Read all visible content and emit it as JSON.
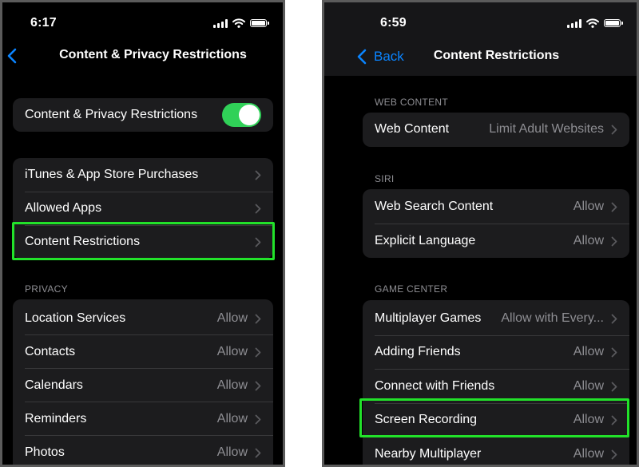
{
  "left": {
    "status_time": "6:17",
    "nav_title": "Content & Privacy Restrictions",
    "toggle": {
      "label": "Content & Privacy Restrictions",
      "on": true
    },
    "group1": [
      {
        "label": "iTunes & App Store Purchases"
      },
      {
        "label": "Allowed Apps"
      },
      {
        "label": "Content Restrictions"
      }
    ],
    "privacy_header": "PRIVACY",
    "privacy": [
      {
        "label": "Location Services",
        "value": "Allow"
      },
      {
        "label": "Contacts",
        "value": "Allow"
      },
      {
        "label": "Calendars",
        "value": "Allow"
      },
      {
        "label": "Reminders",
        "value": "Allow"
      },
      {
        "label": "Photos",
        "value": "Allow"
      }
    ]
  },
  "right": {
    "status_time": "6:59",
    "back_label": "Back",
    "nav_title": "Content Restrictions",
    "web_header": "WEB CONTENT",
    "web": [
      {
        "label": "Web Content",
        "value": "Limit Adult Websites"
      }
    ],
    "siri_header": "SIRI",
    "siri": [
      {
        "label": "Web Search Content",
        "value": "Allow"
      },
      {
        "label": "Explicit Language",
        "value": "Allow"
      }
    ],
    "game_header": "GAME CENTER",
    "game": [
      {
        "label": "Multiplayer Games",
        "value": "Allow with Every..."
      },
      {
        "label": "Adding Friends",
        "value": "Allow"
      },
      {
        "label": "Connect with Friends",
        "value": "Allow"
      },
      {
        "label": "Screen Recording",
        "value": "Allow"
      },
      {
        "label": "Nearby Multiplayer",
        "value": "Allow"
      }
    ]
  },
  "colors": {
    "highlight": "#22e22a",
    "toggle_on": "#30d158",
    "link_blue": "#0a84ff",
    "cell_bg": "#1c1c1e"
  },
  "icons": {
    "chevron": "chevron-right-icon",
    "back": "chevron-left-icon",
    "signal": "cellular-signal-icon",
    "wifi": "wifi-icon",
    "battery": "battery-icon"
  }
}
